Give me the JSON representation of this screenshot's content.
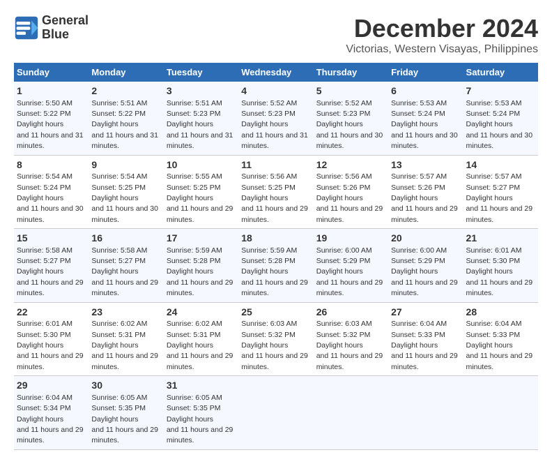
{
  "header": {
    "logo_line1": "General",
    "logo_line2": "Blue",
    "month": "December 2024",
    "location": "Victorias, Western Visayas, Philippines"
  },
  "days_of_week": [
    "Sunday",
    "Monday",
    "Tuesday",
    "Wednesday",
    "Thursday",
    "Friday",
    "Saturday"
  ],
  "weeks": [
    [
      {
        "day": "1",
        "sunrise": "5:50 AM",
        "sunset": "5:22 PM",
        "daylight": "11 hours and 31 minutes."
      },
      {
        "day": "2",
        "sunrise": "5:51 AM",
        "sunset": "5:22 PM",
        "daylight": "11 hours and 31 minutes."
      },
      {
        "day": "3",
        "sunrise": "5:51 AM",
        "sunset": "5:23 PM",
        "daylight": "11 hours and 31 minutes."
      },
      {
        "day": "4",
        "sunrise": "5:52 AM",
        "sunset": "5:23 PM",
        "daylight": "11 hours and 31 minutes."
      },
      {
        "day": "5",
        "sunrise": "5:52 AM",
        "sunset": "5:23 PM",
        "daylight": "11 hours and 30 minutes."
      },
      {
        "day": "6",
        "sunrise": "5:53 AM",
        "sunset": "5:24 PM",
        "daylight": "11 hours and 30 minutes."
      },
      {
        "day": "7",
        "sunrise": "5:53 AM",
        "sunset": "5:24 PM",
        "daylight": "11 hours and 30 minutes."
      }
    ],
    [
      {
        "day": "8",
        "sunrise": "5:54 AM",
        "sunset": "5:24 PM",
        "daylight": "11 hours and 30 minutes."
      },
      {
        "day": "9",
        "sunrise": "5:54 AM",
        "sunset": "5:25 PM",
        "daylight": "11 hours and 30 minutes."
      },
      {
        "day": "10",
        "sunrise": "5:55 AM",
        "sunset": "5:25 PM",
        "daylight": "11 hours and 29 minutes."
      },
      {
        "day": "11",
        "sunrise": "5:56 AM",
        "sunset": "5:25 PM",
        "daylight": "11 hours and 29 minutes."
      },
      {
        "day": "12",
        "sunrise": "5:56 AM",
        "sunset": "5:26 PM",
        "daylight": "11 hours and 29 minutes."
      },
      {
        "day": "13",
        "sunrise": "5:57 AM",
        "sunset": "5:26 PM",
        "daylight": "11 hours and 29 minutes."
      },
      {
        "day": "14",
        "sunrise": "5:57 AM",
        "sunset": "5:27 PM",
        "daylight": "11 hours and 29 minutes."
      }
    ],
    [
      {
        "day": "15",
        "sunrise": "5:58 AM",
        "sunset": "5:27 PM",
        "daylight": "11 hours and 29 minutes."
      },
      {
        "day": "16",
        "sunrise": "5:58 AM",
        "sunset": "5:27 PM",
        "daylight": "11 hours and 29 minutes."
      },
      {
        "day": "17",
        "sunrise": "5:59 AM",
        "sunset": "5:28 PM",
        "daylight": "11 hours and 29 minutes."
      },
      {
        "day": "18",
        "sunrise": "5:59 AM",
        "sunset": "5:28 PM",
        "daylight": "11 hours and 29 minutes."
      },
      {
        "day": "19",
        "sunrise": "6:00 AM",
        "sunset": "5:29 PM",
        "daylight": "11 hours and 29 minutes."
      },
      {
        "day": "20",
        "sunrise": "6:00 AM",
        "sunset": "5:29 PM",
        "daylight": "11 hours and 29 minutes."
      },
      {
        "day": "21",
        "sunrise": "6:01 AM",
        "sunset": "5:30 PM",
        "daylight": "11 hours and 29 minutes."
      }
    ],
    [
      {
        "day": "22",
        "sunrise": "6:01 AM",
        "sunset": "5:30 PM",
        "daylight": "11 hours and 29 minutes."
      },
      {
        "day": "23",
        "sunrise": "6:02 AM",
        "sunset": "5:31 PM",
        "daylight": "11 hours and 29 minutes."
      },
      {
        "day": "24",
        "sunrise": "6:02 AM",
        "sunset": "5:31 PM",
        "daylight": "11 hours and 29 minutes."
      },
      {
        "day": "25",
        "sunrise": "6:03 AM",
        "sunset": "5:32 PM",
        "daylight": "11 hours and 29 minutes."
      },
      {
        "day": "26",
        "sunrise": "6:03 AM",
        "sunset": "5:32 PM",
        "daylight": "11 hours and 29 minutes."
      },
      {
        "day": "27",
        "sunrise": "6:04 AM",
        "sunset": "5:33 PM",
        "daylight": "11 hours and 29 minutes."
      },
      {
        "day": "28",
        "sunrise": "6:04 AM",
        "sunset": "5:33 PM",
        "daylight": "11 hours and 29 minutes."
      }
    ],
    [
      {
        "day": "29",
        "sunrise": "6:04 AM",
        "sunset": "5:34 PM",
        "daylight": "11 hours and 29 minutes."
      },
      {
        "day": "30",
        "sunrise": "6:05 AM",
        "sunset": "5:35 PM",
        "daylight": "11 hours and 29 minutes."
      },
      {
        "day": "31",
        "sunrise": "6:05 AM",
        "sunset": "5:35 PM",
        "daylight": "11 hours and 29 minutes."
      },
      {
        "day": "",
        "sunrise": "",
        "sunset": "",
        "daylight": ""
      },
      {
        "day": "",
        "sunrise": "",
        "sunset": "",
        "daylight": ""
      },
      {
        "day": "",
        "sunrise": "",
        "sunset": "",
        "daylight": ""
      },
      {
        "day": "",
        "sunrise": "",
        "sunset": "",
        "daylight": ""
      }
    ]
  ]
}
